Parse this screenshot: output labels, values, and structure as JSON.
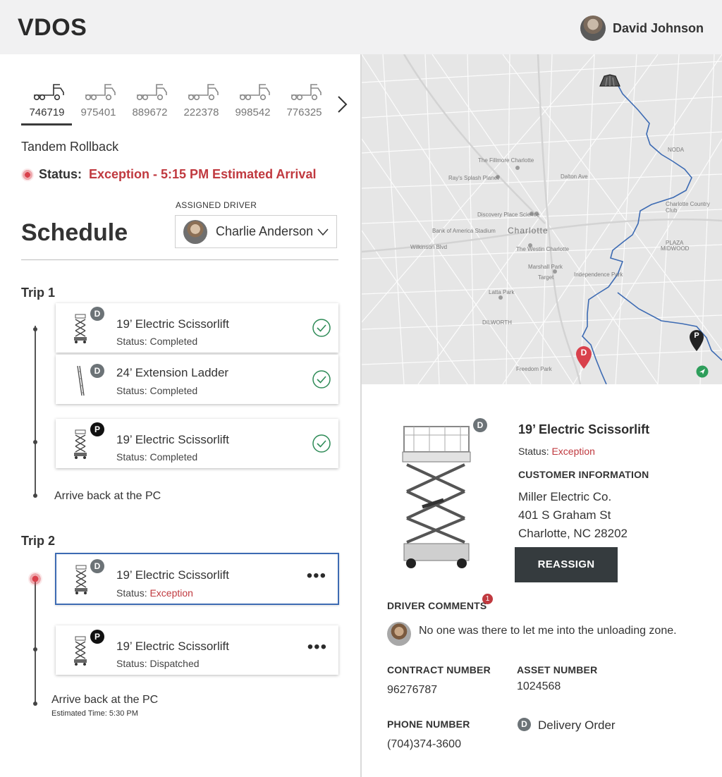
{
  "app": {
    "brand": "VDOS"
  },
  "user": {
    "name": "David Johnson"
  },
  "vehicles": [
    {
      "id": "746719",
      "active": true
    },
    {
      "id": "975401"
    },
    {
      "id": "889672"
    },
    {
      "id": "222378"
    },
    {
      "id": "998542"
    },
    {
      "id": "776325"
    }
  ],
  "vehicle_type": "Tandem Rollback",
  "status": {
    "label": "Status:",
    "value": "Exception - 5:15 PM Estimated Arrival"
  },
  "driver": {
    "label": "ASSIGNED DRIVER",
    "name": "Charlie Anderson"
  },
  "schedule": {
    "title": "Schedule",
    "trip1": {
      "label": "Trip 1",
      "items": [
        {
          "badge": "D",
          "title": "19’ Electric Scissorlift",
          "status_prefix": "Status: ",
          "status": "Completed"
        },
        {
          "badge": "D",
          "title": "24’ Extension Ladder",
          "status_prefix": "Status: ",
          "status": "Completed"
        },
        {
          "badge": "P",
          "title": "19’ Electric Scissorlift",
          "status_prefix": "Status: ",
          "status": "Completed"
        }
      ],
      "arrive": "Arrive back at the PC"
    },
    "trip2": {
      "label": "Trip 2",
      "items": [
        {
          "badge": "D",
          "title": "19’ Electric Scissorlift",
          "status_prefix": "Status: ",
          "status": "Exception"
        },
        {
          "badge": "P",
          "title": "19’ Electric Scissorlift",
          "status_prefix": "Status: ",
          "status": "Dispatched"
        }
      ],
      "arrive": "Arrive back at the PC",
      "estimated": "Estimated Time: 5:30 PM"
    }
  },
  "map": {
    "labels": {
      "charlotte": "Charlotte",
      "fillmore": "The Fillmore Charlotte",
      "splash": "Ray's Splash Planet",
      "dalton": "Dalton Ave",
      "discovery": "Discovery Place Science",
      "boa": "Bank of America Stadium",
      "westin": "The Westin Charlotte",
      "marshall": "Marshall Park",
      "independence": "Independence Park",
      "target": "Target",
      "latta": "Latta Park",
      "dilworth": "DILWORTH",
      "freedom": "Freedom Park",
      "plaza": "PLAZA",
      "midwood": "MIDWOOD",
      "noda": "NODA",
      "countryclub": "Charlotte Country Club",
      "wilkinson": "Wilkinson Blvd"
    },
    "pin_d": "D",
    "pin_p": "P"
  },
  "detail": {
    "badge": "D",
    "title": "19’ Electric Scissorlift",
    "status_prefix": "Status: ",
    "status": "Exception",
    "customer_heading": "CUSTOMER INFORMATION",
    "customer_name": "Miller Electric Co.",
    "customer_street": "401 S Graham St",
    "customer_city": "Charlotte, NC 28202",
    "reassign": "REASSIGN",
    "comments_heading": "DRIVER COMMENTS",
    "comments_count": "1",
    "comment": "No one was there to let me into the unloading zone.",
    "contract_heading": "CONTRACT NUMBER",
    "contract": "96276787",
    "asset_heading": "ASSET NUMBER",
    "asset": "1024568",
    "phone_heading": "PHONE NUMBER",
    "phone": "(704)374-3600",
    "order_badge": "D",
    "order_type": "Delivery Order"
  },
  "colors": {
    "exception": "#c0393f",
    "route": "#3d6bb3",
    "check": "#2e8b57",
    "button": "#353b3e"
  }
}
